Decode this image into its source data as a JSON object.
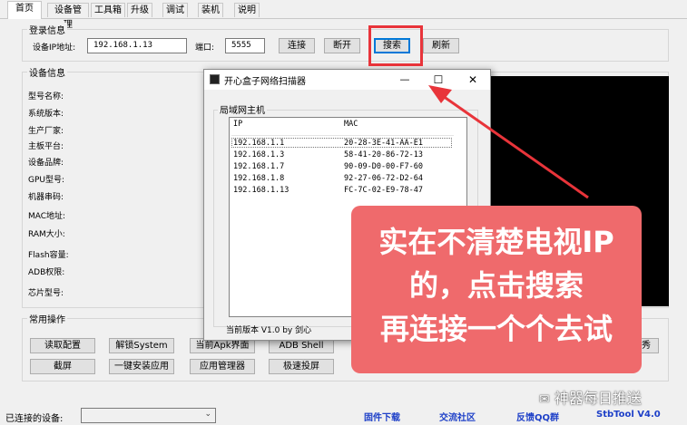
{
  "tabs": [
    "首页",
    "设备管理",
    "工具箱",
    "升级",
    "调试",
    "装机",
    "说明"
  ],
  "login": {
    "group_title": "登录信息",
    "ip_label": "设备IP地址:",
    "ip_value": "192.168.1.13",
    "port_label": "端口:",
    "port_value": "5555",
    "connect": "连接",
    "disconnect": "断开",
    "search": "搜索",
    "refresh": "刷新"
  },
  "device_info": {
    "group_title": "设备信息",
    "labels": [
      "型号名称:",
      "系统版本:",
      "生产厂家:",
      "主板平台:",
      "设备品牌:",
      "GPU型号:",
      "机器串码:",
      "MAC地址:",
      "RAM大小:",
      "Flash容量:",
      "ADB权限:",
      "芯片型号:"
    ]
  },
  "common_ops": {
    "group_title": "常用操作",
    "buttons_row1": [
      "读取配置",
      "解锁System",
      "当前Apk界面",
      "ADB Shell"
    ],
    "buttons_row2": [
      "截屏",
      "一键安装应用",
      "应用管理器",
      "极速投屏"
    ],
    "partial_right": "秀"
  },
  "footer": {
    "connected_label": "已连接的设备:",
    "firmware_download": "固件下载",
    "community": "交流社区",
    "qq_group": "反馈QQ群",
    "version": "StbTool V4.0"
  },
  "dialog": {
    "title": "开心盒子网络扫描器",
    "group_title": "局域网主机",
    "col_ip": "IP",
    "col_mac": "MAC",
    "hosts": [
      {
        "ip": "192.168.1.1",
        "mac": "20-28-3E-41-AA-E1"
      },
      {
        "ip": "192.168.1.3",
        "mac": "58-41-20-86-72-13"
      },
      {
        "ip": "192.168.1.7",
        "mac": "90-09-D0-00-F7-60"
      },
      {
        "ip": "192.168.1.8",
        "mac": "92-27-06-72-D2-64"
      },
      {
        "ip": "192.168.1.13",
        "mac": "FC-7C-02-E9-78-47"
      }
    ],
    "version_text": "当前版本 V1.0  by 剑心",
    "minimize": "—",
    "maximize": "☐",
    "close": "✕"
  },
  "callout": {
    "lines": [
      "实在不清楚电视IP",
      "的，点击搜索",
      "再连接一个个去试"
    ],
    "color": "#ef6a6c"
  },
  "watermark": "神器每日推送"
}
